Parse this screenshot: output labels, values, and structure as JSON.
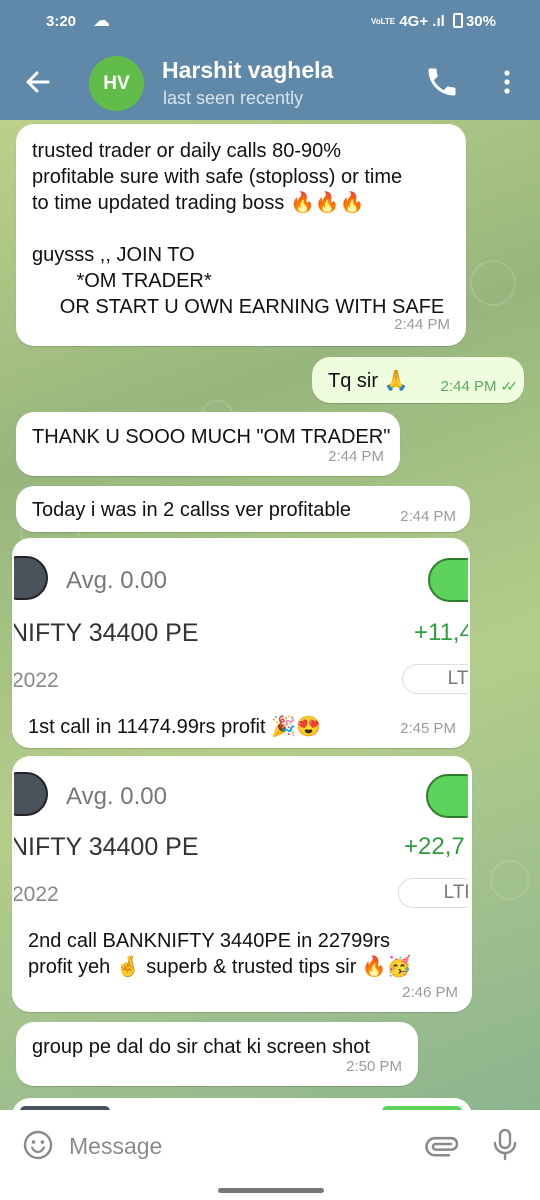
{
  "status_bar": {
    "time": "3:20",
    "cloud_icon": "cloud-icon",
    "network": "4G+",
    "network_badge": "VoLTE",
    "battery": "30%"
  },
  "header": {
    "avatar_initials": "HV",
    "avatar_color": "#62bc4a",
    "name": "Harshit vaghela",
    "status": "last seen recently",
    "bar_color": "#5f88a9"
  },
  "messages": [
    {
      "dir": "in",
      "text": "trusted trader or daily calls 80-90%\nprofitable sure with safe (stoploss) or time\nto time updated trading boss 🔥🔥🔥\n\nguysss ,, JOIN TO\n        *OM TRADER*\n     OR START U OWN EARNING WITH SAFE",
      "time": "2:44 PM"
    },
    {
      "dir": "out",
      "text": "Tq sir 🙏",
      "time": "2:44 PM"
    },
    {
      "dir": "in",
      "text": "THANK U SOOO MUCH \"OM TRADER\"",
      "time": "2:44 PM"
    },
    {
      "dir": "in",
      "text": "Today i was in 2 callss ver profitable",
      "time": "2:44 PM"
    },
    {
      "dir": "in",
      "image": {
        "avg": "Avg. 0.00",
        "instrument": "NIFTY 34400 PE",
        "pnl": "+11,4",
        "year": "2022",
        "ltp": "LTP"
      },
      "text": "1st call in 11474.99rs profit 🎉😍",
      "time": "2:45 PM"
    },
    {
      "dir": "in",
      "image": {
        "avg": "Avg. 0.00",
        "instrument": "NIFTY 34400 PE",
        "pnl": "+22,7",
        "year": "2022",
        "ltp": "LTP"
      },
      "text": "2nd call BANKNIFTY 3440PE in 22799rs\nprofit yeh 🤞 superb & trusted tips sir 🔥🥳",
      "time": "2:46 PM"
    },
    {
      "dir": "in",
      "text": "group pe dal do sir chat ki screen shot",
      "time": "2:50 PM"
    }
  ],
  "composer": {
    "placeholder": "Message"
  },
  "colors": {
    "incoming_bubble": "#ffffff",
    "outgoing_bubble": "#effdde",
    "profit_green": "#2e9e3e",
    "tick_green": "#4fae4e"
  }
}
